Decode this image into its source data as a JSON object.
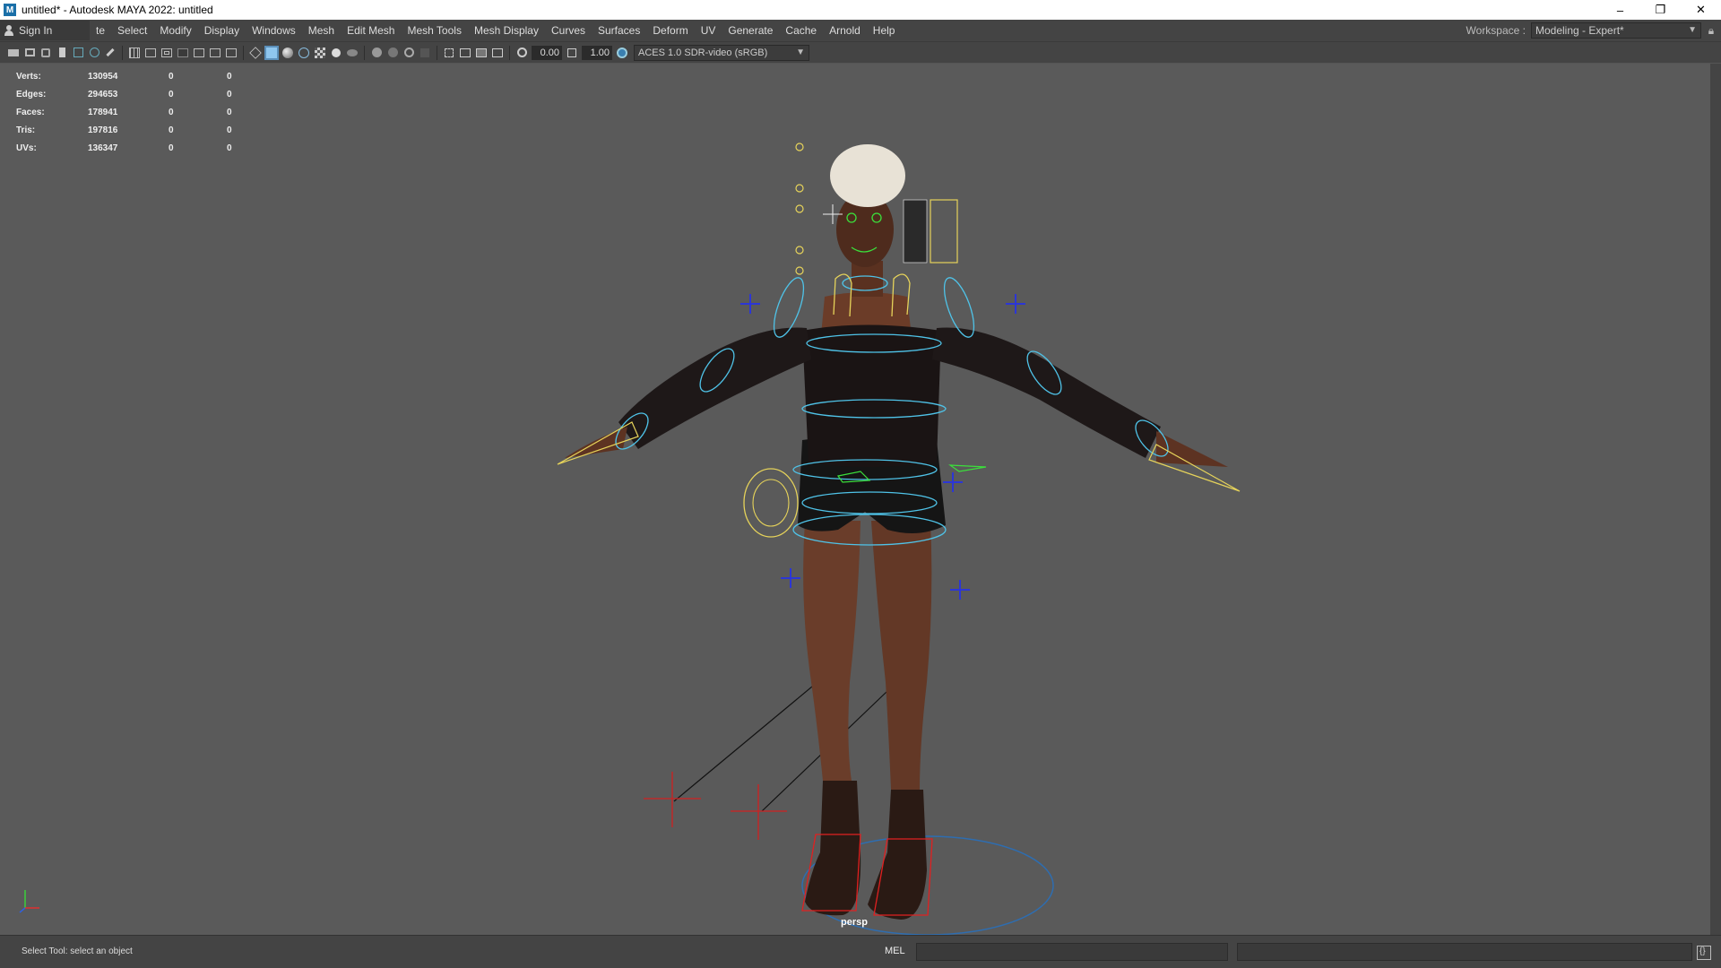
{
  "window": {
    "title": "untitled* - Autodesk MAYA 2022: untitled",
    "icon": "M",
    "minimize": "–",
    "restore": "❐",
    "close": "✕"
  },
  "menubar": {
    "sign_in": "Sign In",
    "items": [
      "te",
      "Select",
      "Modify",
      "Display",
      "Windows",
      "Mesh",
      "Edit Mesh",
      "Mesh Tools",
      "Mesh Display",
      "Curves",
      "Surfaces",
      "Deform",
      "UV",
      "Generate",
      "Cache",
      "Arnold",
      "Help"
    ],
    "workspace_label": "Workspace :",
    "workspace_value": "Modeling - Expert*"
  },
  "toolbar": {
    "exposure": "0.00",
    "gamma": "1.00",
    "color_management": "ACES 1.0 SDR-video (sRGB)"
  },
  "hud": {
    "rows": [
      {
        "label": "Verts:",
        "v1": "130954",
        "v2": "0",
        "v3": "0"
      },
      {
        "label": "Edges:",
        "v1": "294653",
        "v2": "0",
        "v3": "0"
      },
      {
        "label": "Faces:",
        "v1": "178941",
        "v2": "0",
        "v3": "0"
      },
      {
        "label": "Tris:",
        "v1": "197816",
        "v2": "0",
        "v3": "0"
      },
      {
        "label": "UVs:",
        "v1": "136347",
        "v2": "0",
        "v3": "0"
      }
    ]
  },
  "viewport": {
    "camera": "persp"
  },
  "status": {
    "message": "Select Tool: select an object",
    "command_language": "MEL"
  }
}
